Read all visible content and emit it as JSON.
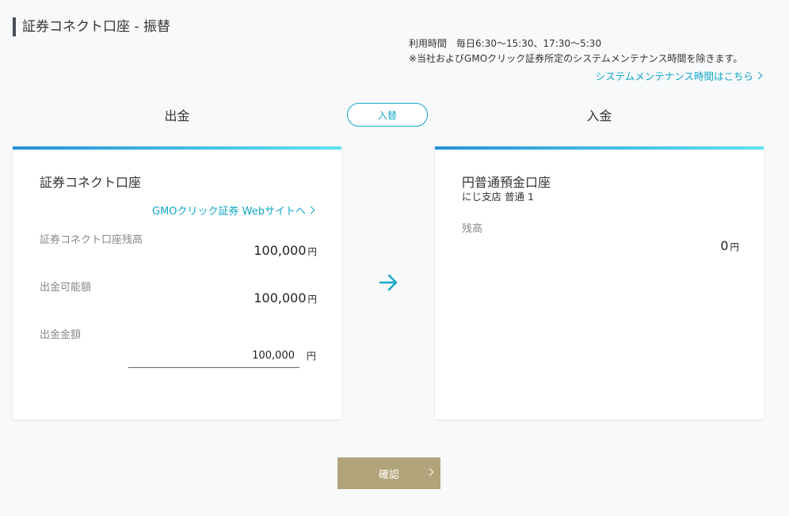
{
  "page": {
    "title": "証券コネクト口座 - 振替"
  },
  "hours": {
    "label": "利用時間",
    "times": "毎日6:30〜15:30、17:30〜5:30",
    "note": "※当社およびGMOクリック証券所定のシステムメンテナンス時間を除きます。",
    "maintenance_link": "システムメンテナンス時間はこちら"
  },
  "columns": {
    "withdraw_title": "出金",
    "deposit_title": "入金",
    "swap_label": "入替"
  },
  "withdraw_card": {
    "title": "証券コネクト口座",
    "web_link": "GMOクリック証券 Webサイトへ",
    "balance_label": "証券コネクト口座残高",
    "balance_value": "100,000",
    "available_label": "出金可能額",
    "available_value": "100,000",
    "amount_label": "出金金額",
    "amount_input_value": "100,000",
    "unit": "円"
  },
  "deposit_card": {
    "title": "円普通預金口座",
    "subtitle": "にじ支店 普通 1",
    "balance_label": "残高",
    "balance_value": "0",
    "unit": "円"
  },
  "actions": {
    "confirm_label": "確認"
  },
  "colors": {
    "accent": "#12a7c6",
    "confirm_button": "#b2a47a",
    "card_top_gradient_start": "#2390d8",
    "card_top_gradient_end": "#5ee3f0"
  },
  "icons": {
    "transfer_arrow": "arrow-right-icon",
    "link_chevron": "chevron-right-icon"
  }
}
